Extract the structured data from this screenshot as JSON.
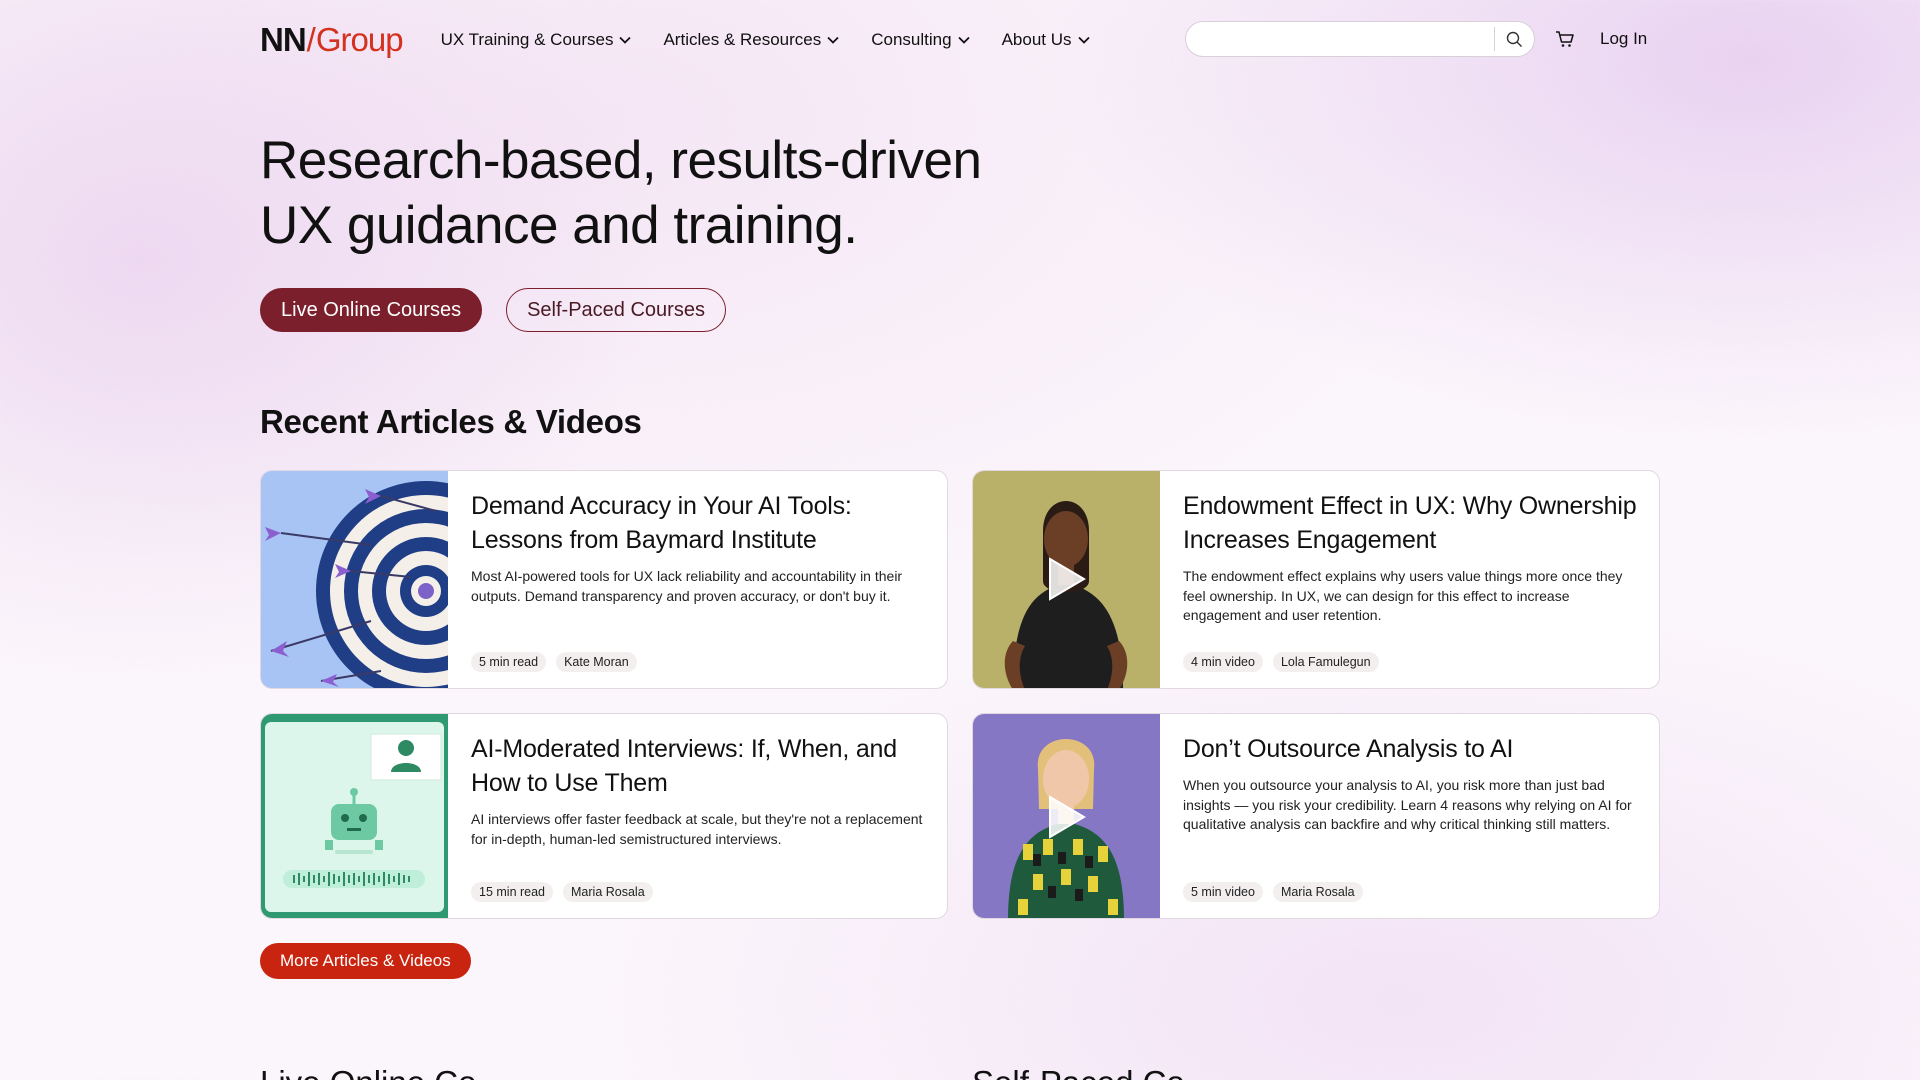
{
  "logo": {
    "nn": "NN",
    "slash": "/",
    "group": "Group"
  },
  "nav": {
    "items": [
      {
        "label": "UX Training & Courses"
      },
      {
        "label": "Articles & Resources"
      },
      {
        "label": "Consulting"
      },
      {
        "label": "About Us"
      }
    ]
  },
  "search": {
    "placeholder": "",
    "value": ""
  },
  "header": {
    "login_label": "Log In"
  },
  "hero": {
    "title_line1": "Research-based, results-driven",
    "title_line2": "UX guidance and training.",
    "btn_live": "Live Online Courses",
    "btn_self": "Self-Paced Courses"
  },
  "recent": {
    "title": "Recent Articles & Videos",
    "cards": [
      {
        "title": "Demand Accuracy in Your AI Tools: Lessons from Baymard Institute",
        "desc": "Most AI-powered tools for UX lack reliability and accountability in their outputs. Demand transparency and proven accuracy, or don't buy it.",
        "duration": "5 min read",
        "author": "Kate Moran",
        "thumb": "target-arrows-illustration"
      },
      {
        "title": "Endowment Effect in UX: Why Ownership Increases Engagement",
        "desc": "The endowment effect explains why users value things more once they feel ownership. In UX, we can design for this effect to increase engagement and user retention.",
        "duration": "4 min video",
        "author": "Lola Famulegun",
        "thumb": "presenter-video"
      },
      {
        "title": "AI-Moderated Interviews: If, When, and How to Use Them",
        "desc": "AI interviews offer faster feedback at scale, but they're not a replacement for in-depth, human-led semistructured interviews.",
        "duration": "15 min read",
        "author": "Maria Rosala",
        "thumb": "robot-interview-illustration"
      },
      {
        "title": "Don’t Outsource Analysis to AI",
        "desc": "When you outsource your analysis to AI, you risk more than just bad insights — you risk your credibility. Learn 4 reasons why relying on AI for qualitative analysis can backfire and why critical thinking still matters.",
        "duration": "5 min video",
        "author": "Maria Rosala",
        "thumb": "presenter-video"
      }
    ],
    "more_label": "More Articles & Videos"
  },
  "bottom": {
    "left_heading": "Live Online Co",
    "right_heading": "Self-Paced Co"
  },
  "colors": {
    "brand_red": "#d2321e",
    "primary_btn": "#7a1f2b",
    "more_btn": "#c8240f"
  }
}
